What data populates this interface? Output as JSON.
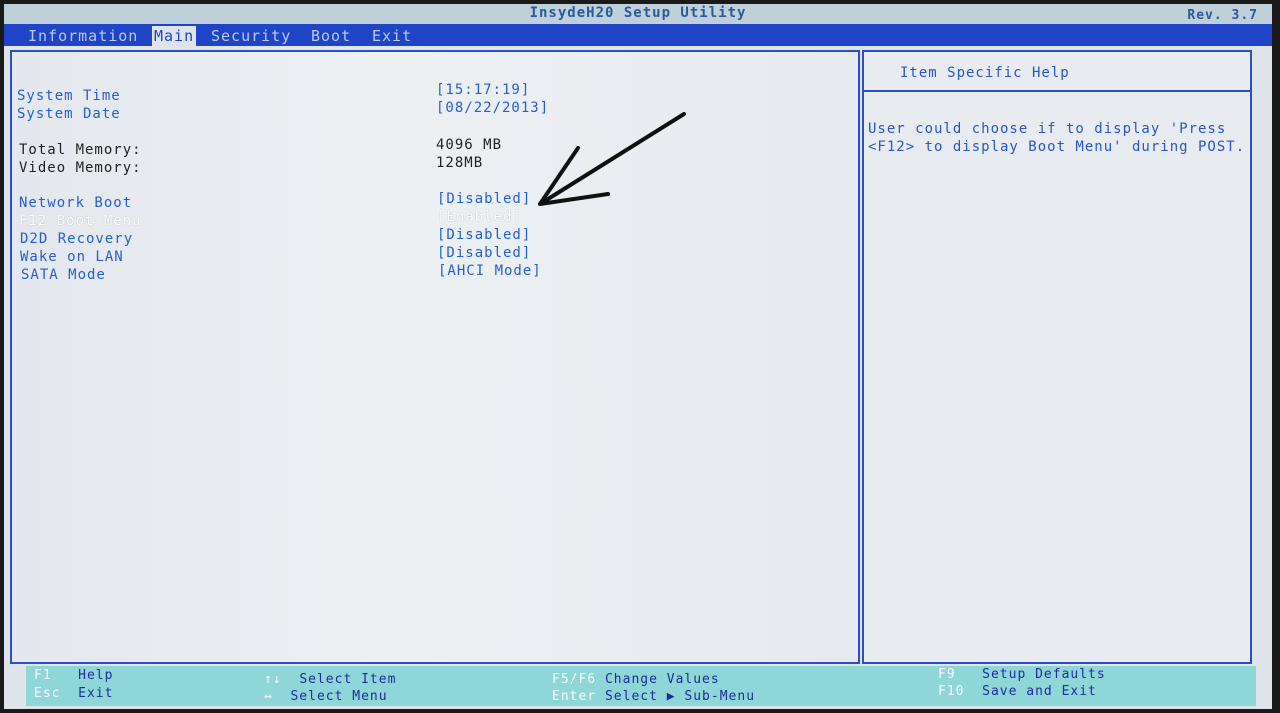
{
  "window": {
    "title": "InsydeH20 Setup Utility",
    "revision": "Rev. 3.7"
  },
  "tabs": [
    {
      "label": "Information",
      "active": false
    },
    {
      "label": "Main",
      "active": true
    },
    {
      "label": "Security",
      "active": false
    },
    {
      "label": "Boot",
      "active": false
    },
    {
      "label": "Exit",
      "active": false
    }
  ],
  "settings": {
    "system_time": {
      "label": "System Time",
      "value": "[15:17:19]"
    },
    "system_date": {
      "label": "System Date",
      "value": "[08/22/2013]"
    },
    "total_memory": {
      "label": "Total Memory:",
      "value": "4096 MB"
    },
    "video_memory": {
      "label": "Video Memory:",
      "value": "128MB"
    },
    "network_boot": {
      "label": "Network Boot",
      "value": "[Disabled]"
    },
    "f12_boot_menu": {
      "label": "F12 Boot Menu",
      "value": "[Enabled]",
      "selected": true
    },
    "d2d_recovery": {
      "label": "D2D Recovery",
      "value": "[Disabled]"
    },
    "wake_on_lan": {
      "label": "Wake on LAN",
      "value": "[Disabled]"
    },
    "sata_mode": {
      "label": "SATA Mode",
      "value": "[AHCI Mode]"
    }
  },
  "help": {
    "header": "Item Specific Help",
    "line1": "User could choose if to display 'Press",
    "line2": "<F12> to display Boot Menu' during POST."
  },
  "footer": {
    "f1": {
      "key": "F1",
      "desc": "Help"
    },
    "esc": {
      "key": "Esc",
      "desc": "Exit"
    },
    "updown": {
      "key": "↑↓",
      "desc": "Select Item"
    },
    "leftright": {
      "key": "↔",
      "desc": "Select Menu"
    },
    "f5f6": {
      "key": "F5/F6",
      "desc": "Change Values"
    },
    "enter": {
      "key": "Enter",
      "desc": "Select ▶ Sub-Menu"
    },
    "f9": {
      "key": "F9",
      "desc": "Setup Defaults"
    },
    "f10": {
      "key": "F10",
      "desc": "Save and Exit"
    }
  },
  "colors": {
    "menubar": "#1f45c6",
    "background": "#dfe4ea",
    "footer": "#8fd6d9",
    "label_blue": "#2560d0"
  },
  "icons": {
    "annotation": "hand-drawn-arrow-icon"
  }
}
